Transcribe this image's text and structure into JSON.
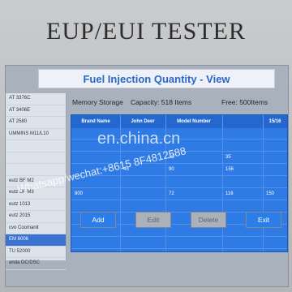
{
  "device": {
    "title": "EUP/EUI TESTER"
  },
  "window": {
    "title": "Fuel Injection Quantity - View"
  },
  "sidebar": {
    "items": [
      {
        "label": "AT 3376C"
      },
      {
        "label": "AT 3406E"
      },
      {
        "label": "AT 2580"
      },
      {
        "label": "UMMINS  M11/L10"
      },
      {
        "label": ""
      },
      {
        "label": ""
      },
      {
        "label": ""
      },
      {
        "label": "eutz BF M2"
      },
      {
        "label": "eutz BF M3"
      },
      {
        "label": "eutz 1013"
      },
      {
        "label": "eutz 2015"
      },
      {
        "label": "cvo Coomanit"
      },
      {
        "label": "EM 6006"
      },
      {
        "label": "TU 52000"
      },
      {
        "label": "anda DC/DSC"
      },
      {
        "label": "ok"
      }
    ],
    "selected_index": 12
  },
  "storage": {
    "label": "Memory Storage",
    "capacity": "Capacity: 518 Items",
    "free": "Free: 500Items"
  },
  "table": {
    "headers": [
      "Brand Name",
      "John Deer",
      "Model Number",
      "",
      "15/16"
    ],
    "rows": [
      [
        "",
        "",
        "",
        "",
        ""
      ],
      [
        "",
        "",
        "",
        "",
        ""
      ],
      [
        "",
        "",
        "20",
        "35",
        ""
      ],
      [
        "",
        "45",
        "90",
        "156",
        ""
      ],
      [
        "",
        "",
        "",
        "",
        ""
      ],
      [
        "800",
        "",
        "72",
        "116",
        "150"
      ],
      [
        "",
        "",
        "",
        "",
        ""
      ],
      [
        "",
        "",
        "",
        "",
        ""
      ],
      [
        "",
        "",
        "",
        "",
        ""
      ],
      [
        "",
        "",
        "",
        "",
        ""
      ]
    ]
  },
  "buttons": {
    "add": "Add",
    "edit": "Edit",
    "delete": "Delete",
    "exit": "Exit"
  },
  "watermark": {
    "site": "en.china.cn",
    "contact": "Whatsapp/wechat:+8615  8F4812588"
  }
}
